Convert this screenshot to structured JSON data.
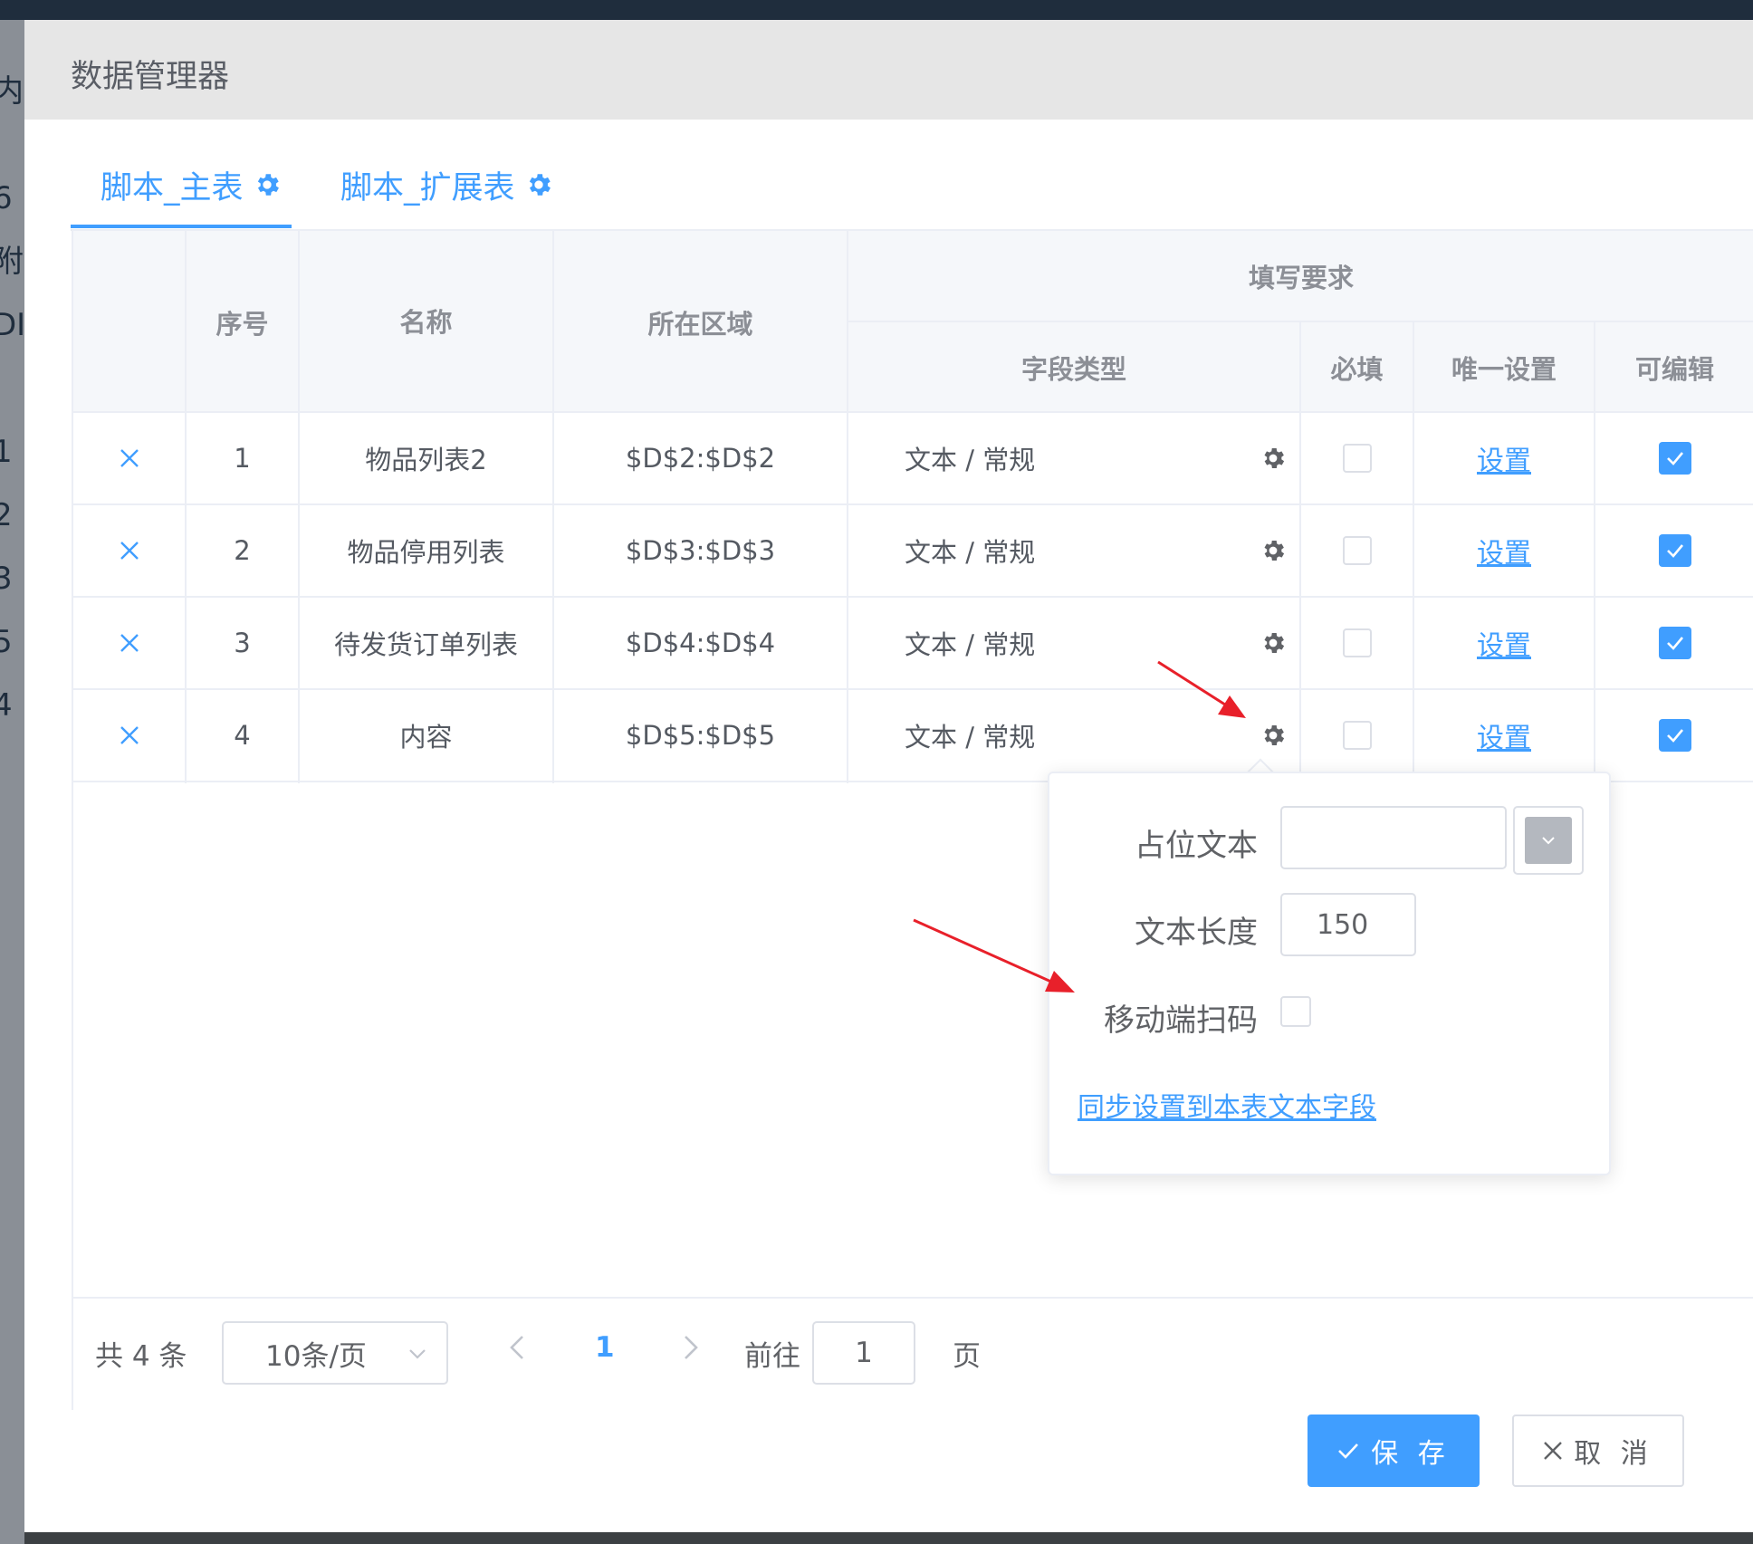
{
  "background_fragments": [
    "6",
    "附",
    "DI",
    "1",
    "2",
    "3",
    "5",
    "4",
    "内"
  ],
  "dialog": {
    "title": "数据管理器"
  },
  "tabs": [
    {
      "label": "脚本_主表",
      "active": true
    },
    {
      "label": "脚本_扩展表",
      "active": false
    }
  ],
  "table": {
    "headers": {
      "index": "序号",
      "name": "名称",
      "area": "所在区域",
      "group": "填写要求",
      "field_type": "字段类型",
      "required": "必填",
      "unique": "唯一设置",
      "editable": "可编辑"
    },
    "rows": [
      {
        "index": "1",
        "name": "物品列表2",
        "area": "$D$2:$D$2",
        "field_type": "文本 / 常规",
        "required": false,
        "unique_link": "设置",
        "editable": true
      },
      {
        "index": "2",
        "name": "物品停用列表",
        "area": "$D$3:$D$3",
        "field_type": "文本 / 常规",
        "required": false,
        "unique_link": "设置",
        "editable": true
      },
      {
        "index": "3",
        "name": "待发货订单列表",
        "area": "$D$4:$D$4",
        "field_type": "文本 / 常规",
        "required": false,
        "unique_link": "设置",
        "editable": true
      },
      {
        "index": "4",
        "name": "内容",
        "area": "$D$5:$D$5",
        "field_type": "文本 / 常规",
        "required": false,
        "unique_link": "设置",
        "editable": true
      }
    ]
  },
  "pagination": {
    "total": "共 4 条",
    "page_size": "10条/页",
    "current_page": "1",
    "goto_label": "前往",
    "goto_value": "1",
    "page_suffix": "页"
  },
  "popover": {
    "placeholder_label": "占位文本",
    "placeholder_value": "",
    "length_label": "文本长度",
    "length_value": "150",
    "scan_label": "移动端扫码",
    "scan_checked": false,
    "sync_link": "同步设置到本表文本字段"
  },
  "buttons": {
    "save": "保 存",
    "cancel": "取 消"
  },
  "colors": {
    "primary": "#409eff",
    "annotation_arrow": "#e8202a"
  }
}
